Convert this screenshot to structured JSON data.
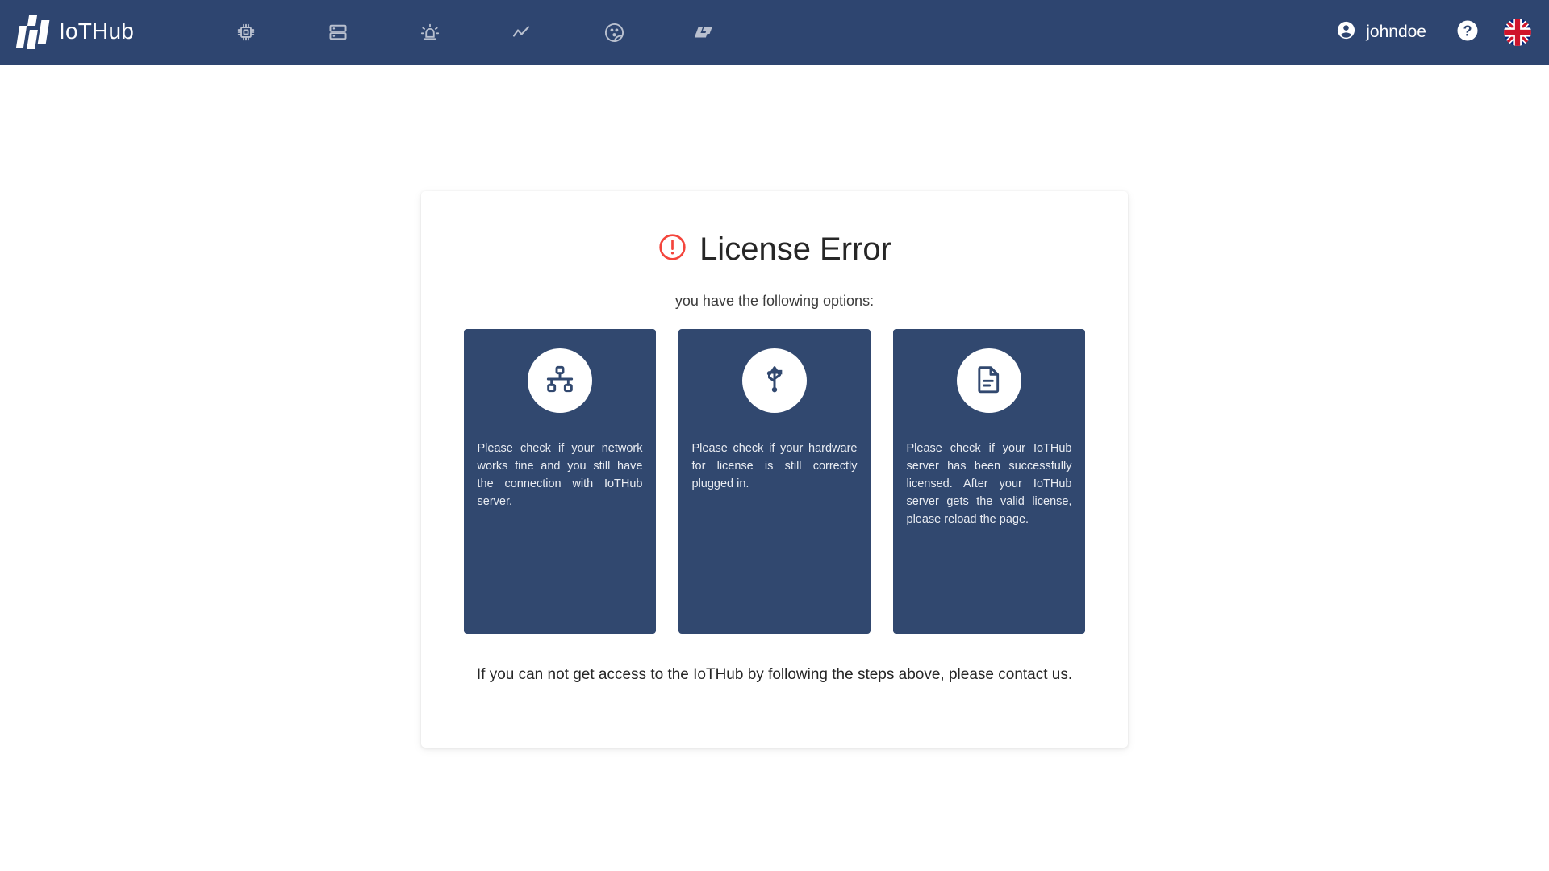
{
  "header": {
    "brand_name": "IoTHub",
    "nav_icons": [
      {
        "name": "chip-icon",
        "label": "Devices"
      },
      {
        "name": "server-icon",
        "label": "Servers"
      },
      {
        "name": "alarm-icon",
        "label": "Alarms"
      },
      {
        "name": "trend-chart-icon",
        "label": "Trends"
      },
      {
        "name": "users-group-icon",
        "label": "Users"
      },
      {
        "name": "lt-logo-icon",
        "label": "LT"
      }
    ],
    "user_name": "johndoe",
    "account_icon": "account-circle-icon",
    "help_icon": "help-circle-icon",
    "language_flag": "uk-flag-icon"
  },
  "main": {
    "error_icon": "error-exclamation-icon",
    "error_title": "License Error",
    "subtitle": "you have the following options:",
    "cards": [
      {
        "icon": "network-topology-icon",
        "text": "Please check if your network works fine and you still have the connection with IoTHub server."
      },
      {
        "icon": "usb-icon",
        "text": "Please check if your hardware for license is still correctly plugged in."
      },
      {
        "icon": "document-icon",
        "text": "Please check if your IoTHub server has been successfully licensed. After your IoTHub server gets the valid license, please reload the page."
      }
    ],
    "footnote": "If you can not get access to the IoTHub by following the steps above, please contact us."
  },
  "colors": {
    "navbar_bg": "#2e4570",
    "card_bg": "#31486f",
    "error_red": "#f4453c",
    "icon_grey": "#b9c0cf",
    "page_bg": "#ffffff"
  }
}
